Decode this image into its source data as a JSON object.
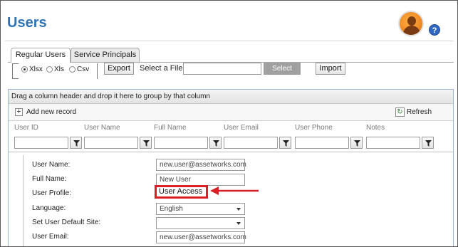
{
  "header": {
    "title": "Users"
  },
  "tabs": [
    {
      "label": "Regular Users",
      "active": true
    },
    {
      "label": "Service Principals",
      "active": false
    }
  ],
  "export": {
    "formats": [
      {
        "label": "Xlsx",
        "selected": true
      },
      {
        "label": "Xls",
        "selected": false
      },
      {
        "label": "Csv",
        "selected": false
      }
    ],
    "export_label": "Export",
    "file_label": "Select a File :",
    "file_value": "",
    "select_label": "Select",
    "import_label": "Import"
  },
  "grid": {
    "group_hint": "Drag a column header and drop it here to group by that column",
    "add_label": "Add new record",
    "refresh_label": "Refresh",
    "columns": [
      "User ID",
      "User Name",
      "Full Name",
      "User Email",
      "User Phone",
      "Notes"
    ]
  },
  "form": {
    "fields": [
      {
        "label": "User Name:",
        "value": "new.user@assetworks.com"
      },
      {
        "label": "Full Name:",
        "value": "New User"
      },
      {
        "label": "User Profile:",
        "value": "User Access"
      },
      {
        "label": "Language:",
        "value": "English"
      },
      {
        "label": "Set User Default Site:",
        "value": ""
      },
      {
        "label": "User Email:",
        "value": "new.user@assetworks.com"
      }
    ]
  },
  "colors": {
    "title": "#2e74b5",
    "highlight": "#d81f26",
    "grid_border": "#9cb6d3"
  },
  "icons": [
    "user-avatar-icon",
    "help-icon",
    "add-icon",
    "refresh-icon",
    "filter-icon",
    "arrow-icon"
  ]
}
